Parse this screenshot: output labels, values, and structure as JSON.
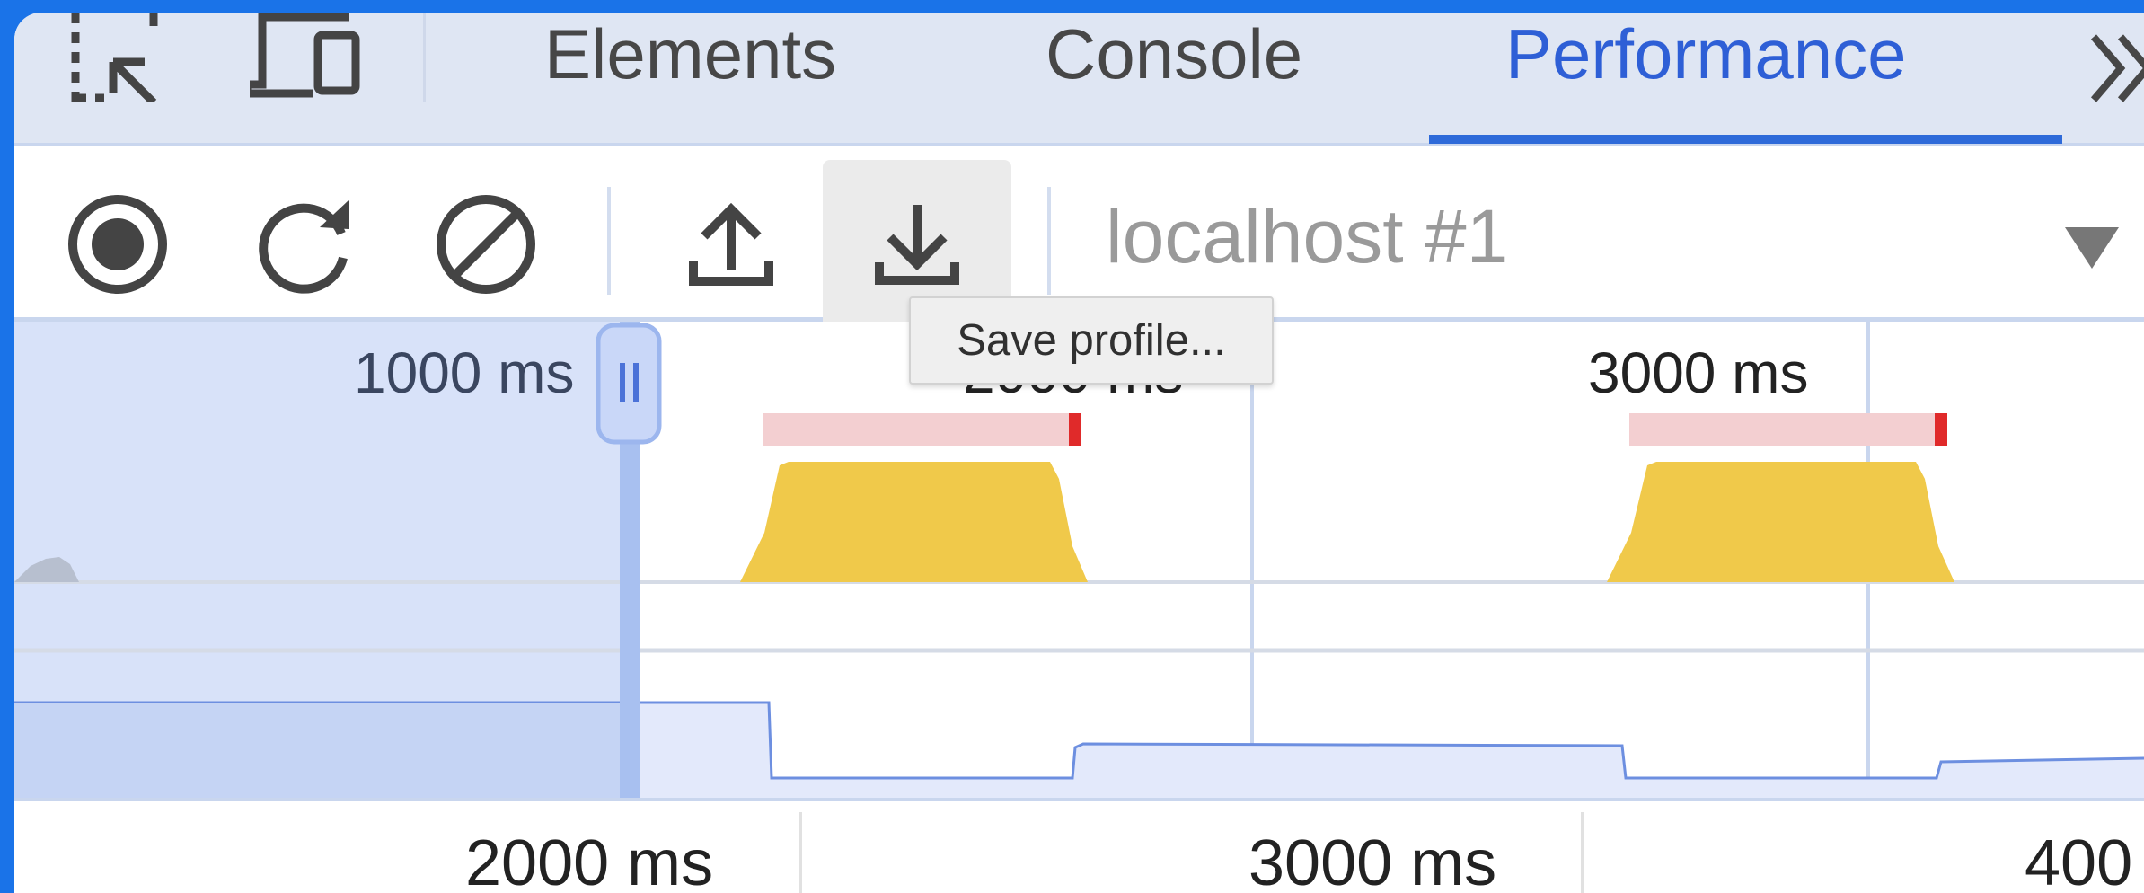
{
  "tabs": [
    {
      "label": "Elements",
      "active": false
    },
    {
      "label": "Console",
      "active": false
    },
    {
      "label": "Performance",
      "active": true
    }
  ],
  "tabbar_icons": [
    "inspect-element-icon",
    "device-toolbar-icon",
    "more-tabs-icon"
  ],
  "toolbar": {
    "buttons": [
      "record-icon",
      "reload-record-icon",
      "clear-icon",
      "load-profile-icon",
      "save-profile-icon"
    ],
    "target": "localhost #1",
    "tooltip": "Save profile..."
  },
  "overview": {
    "ticks": [
      "1000 ms",
      "2000 ms",
      "3000 ms"
    ]
  },
  "ruler": {
    "ticks": [
      "2000 ms",
      "3000 ms",
      "400"
    ]
  },
  "colors": {
    "accent": "#2e6ad9",
    "scripting": "#f0c94a",
    "long_task": "#f3cfd1",
    "long_task_marker": "#e02a2a",
    "selection_shade": "#d8e2f9"
  }
}
